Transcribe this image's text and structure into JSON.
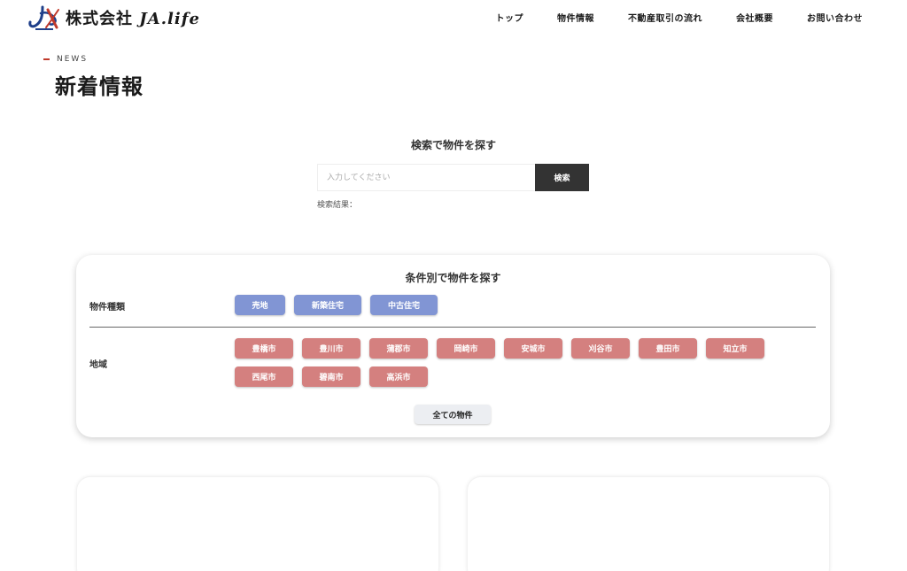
{
  "header": {
    "company_prefix": "株式会社",
    "company_name": "JA.life",
    "nav": [
      "トップ",
      "物件情報",
      "不動産取引の流れ",
      "会社概要",
      "お問い合わせ"
    ]
  },
  "news": {
    "label": "NEWS",
    "title": "新着情報"
  },
  "search": {
    "heading": "検索で物件を探す",
    "placeholder": "入力してください",
    "value": "",
    "button": "検索",
    "result_label": "検索結果："
  },
  "filter": {
    "title": "条件別で物件を探す",
    "type_label": "物件種類",
    "types": [
      "売地",
      "新築住宅",
      "中古住宅"
    ],
    "area_label": "地域",
    "areas": [
      "豊橋市",
      "豊川市",
      "蒲郡市",
      "岡崎市",
      "安城市",
      "刈谷市",
      "豊田市",
      "知立市",
      "西尾市",
      "碧南市",
      "高浜市"
    ],
    "all_button": "全ての物件"
  },
  "colors": {
    "type_chip": "#8195d4",
    "area_chip": "#d4807f",
    "search_button": "#333333",
    "accent": "#c0392b"
  }
}
